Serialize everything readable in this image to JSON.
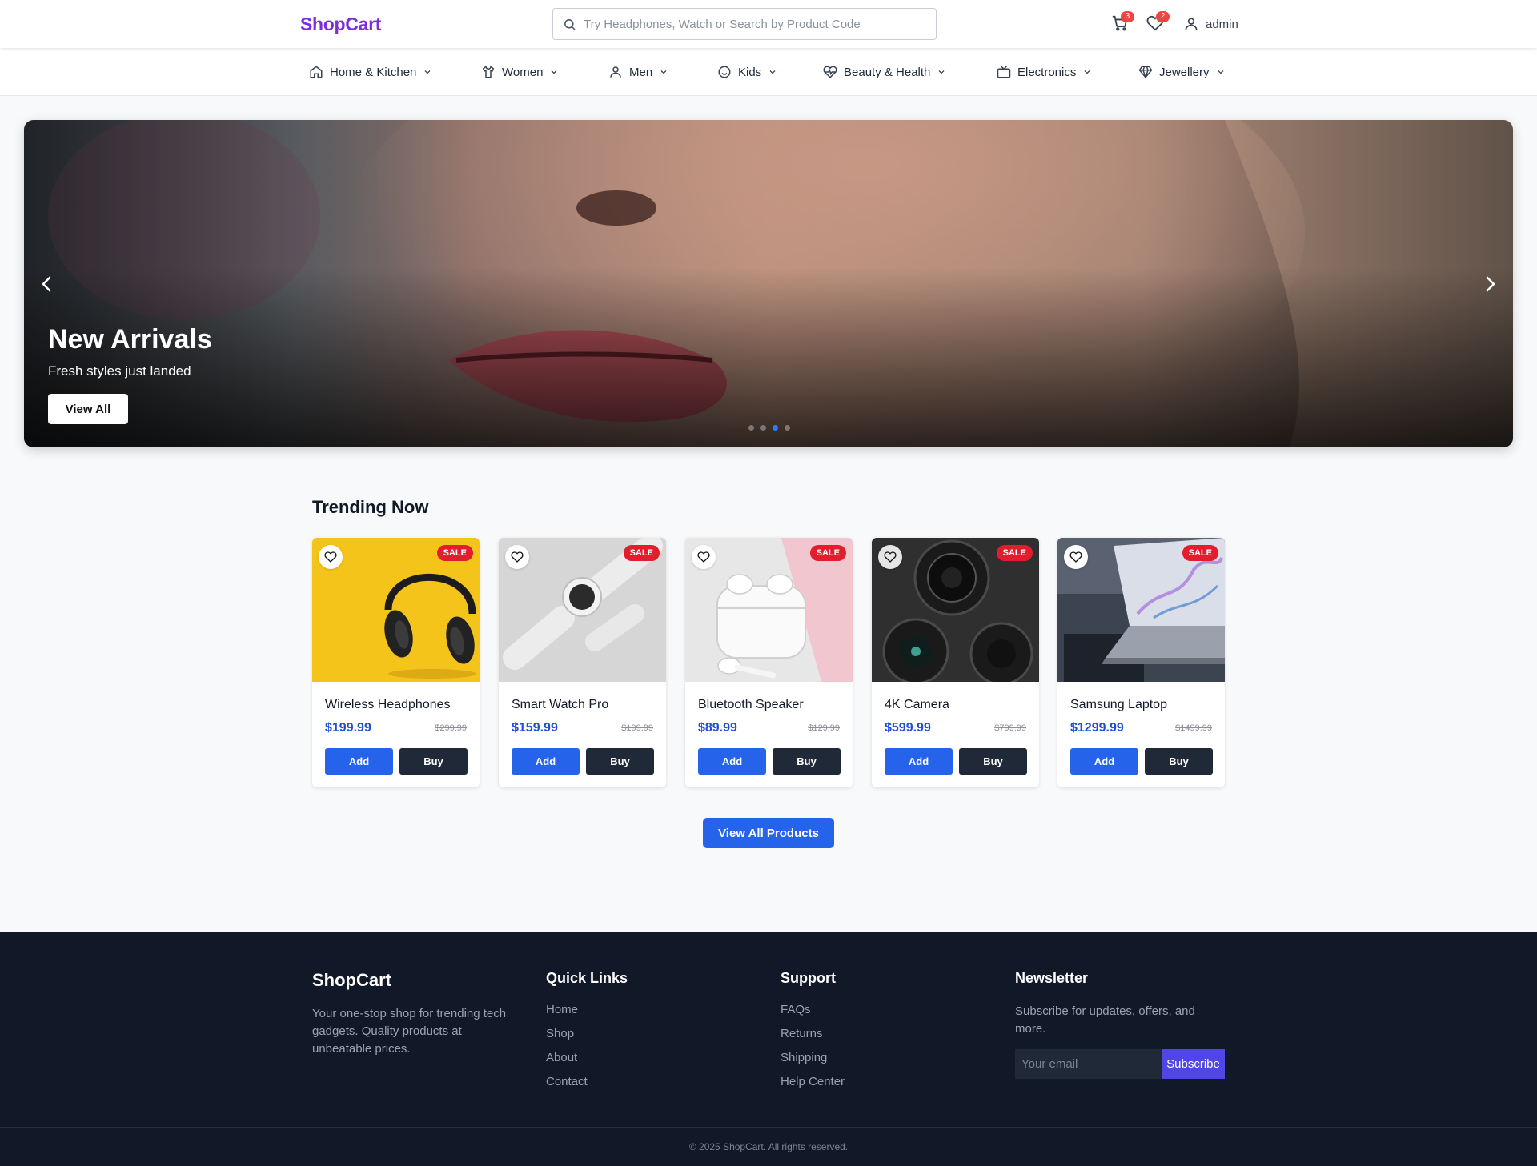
{
  "header": {
    "logo": "ShopCart",
    "search_placeholder": "Try Headphones, Watch or Search by Product Code",
    "cart_count": "3",
    "wishlist_count": "2",
    "username": "admin"
  },
  "nav": [
    {
      "label": "Home & Kitchen",
      "icon": "home-icon"
    },
    {
      "label": "Women",
      "icon": "shirt-icon"
    },
    {
      "label": "Men",
      "icon": "user-icon"
    },
    {
      "label": "Kids",
      "icon": "smile-icon"
    },
    {
      "label": "Beauty & Health",
      "icon": "heart-pulse-icon"
    },
    {
      "label": "Electronics",
      "icon": "tv-icon"
    },
    {
      "label": "Jewellery",
      "icon": "gem-icon"
    }
  ],
  "hero": {
    "title": "New Arrivals",
    "subtitle": "Fresh styles just landed",
    "button": "View All",
    "slide_count": 4,
    "active_slide": 3
  },
  "trending": {
    "title": "Trending Now",
    "products": [
      {
        "name": "Wireless Headphones",
        "price": "$199.99",
        "old_price": "$299.99",
        "badge": "SALE",
        "add_label": "Add",
        "buy_label": "Buy"
      },
      {
        "name": "Smart Watch Pro",
        "price": "$159.99",
        "old_price": "$199.99",
        "badge": "SALE",
        "add_label": "Add",
        "buy_label": "Buy"
      },
      {
        "name": "Bluetooth Speaker",
        "price": "$89.99",
        "old_price": "$129.99",
        "badge": "SALE",
        "add_label": "Add",
        "buy_label": "Buy"
      },
      {
        "name": "4K Camera",
        "price": "$599.99",
        "old_price": "$799.99",
        "badge": "SALE",
        "add_label": "Add",
        "buy_label": "Buy"
      },
      {
        "name": "Samsung Laptop",
        "price": "$1299.99",
        "old_price": "$1499.99",
        "badge": "SALE",
        "add_label": "Add",
        "buy_label": "Buy"
      }
    ],
    "view_all": "View All Products"
  },
  "footer": {
    "brand": "ShopCart",
    "description": "Your one-stop shop for trending tech gadgets. Quality products at unbeatable prices.",
    "quick_links": {
      "title": "Quick Links",
      "items": [
        "Home",
        "Shop",
        "About",
        "Contact"
      ]
    },
    "support": {
      "title": "Support",
      "items": [
        "FAQs",
        "Returns",
        "Shipping",
        "Help Center"
      ]
    },
    "newsletter": {
      "title": "Newsletter",
      "text": "Subscribe for updates, offers, and more.",
      "placeholder": "Your email",
      "button": "Subscribe"
    },
    "copyright": "© 2025 ShopCart. All rights reserved."
  },
  "colors": {
    "brand": "#7c2fd9",
    "primary": "#2563eb",
    "dark": "#1f2937",
    "sale": "#e11d2e",
    "footer_bg": "#111827"
  }
}
